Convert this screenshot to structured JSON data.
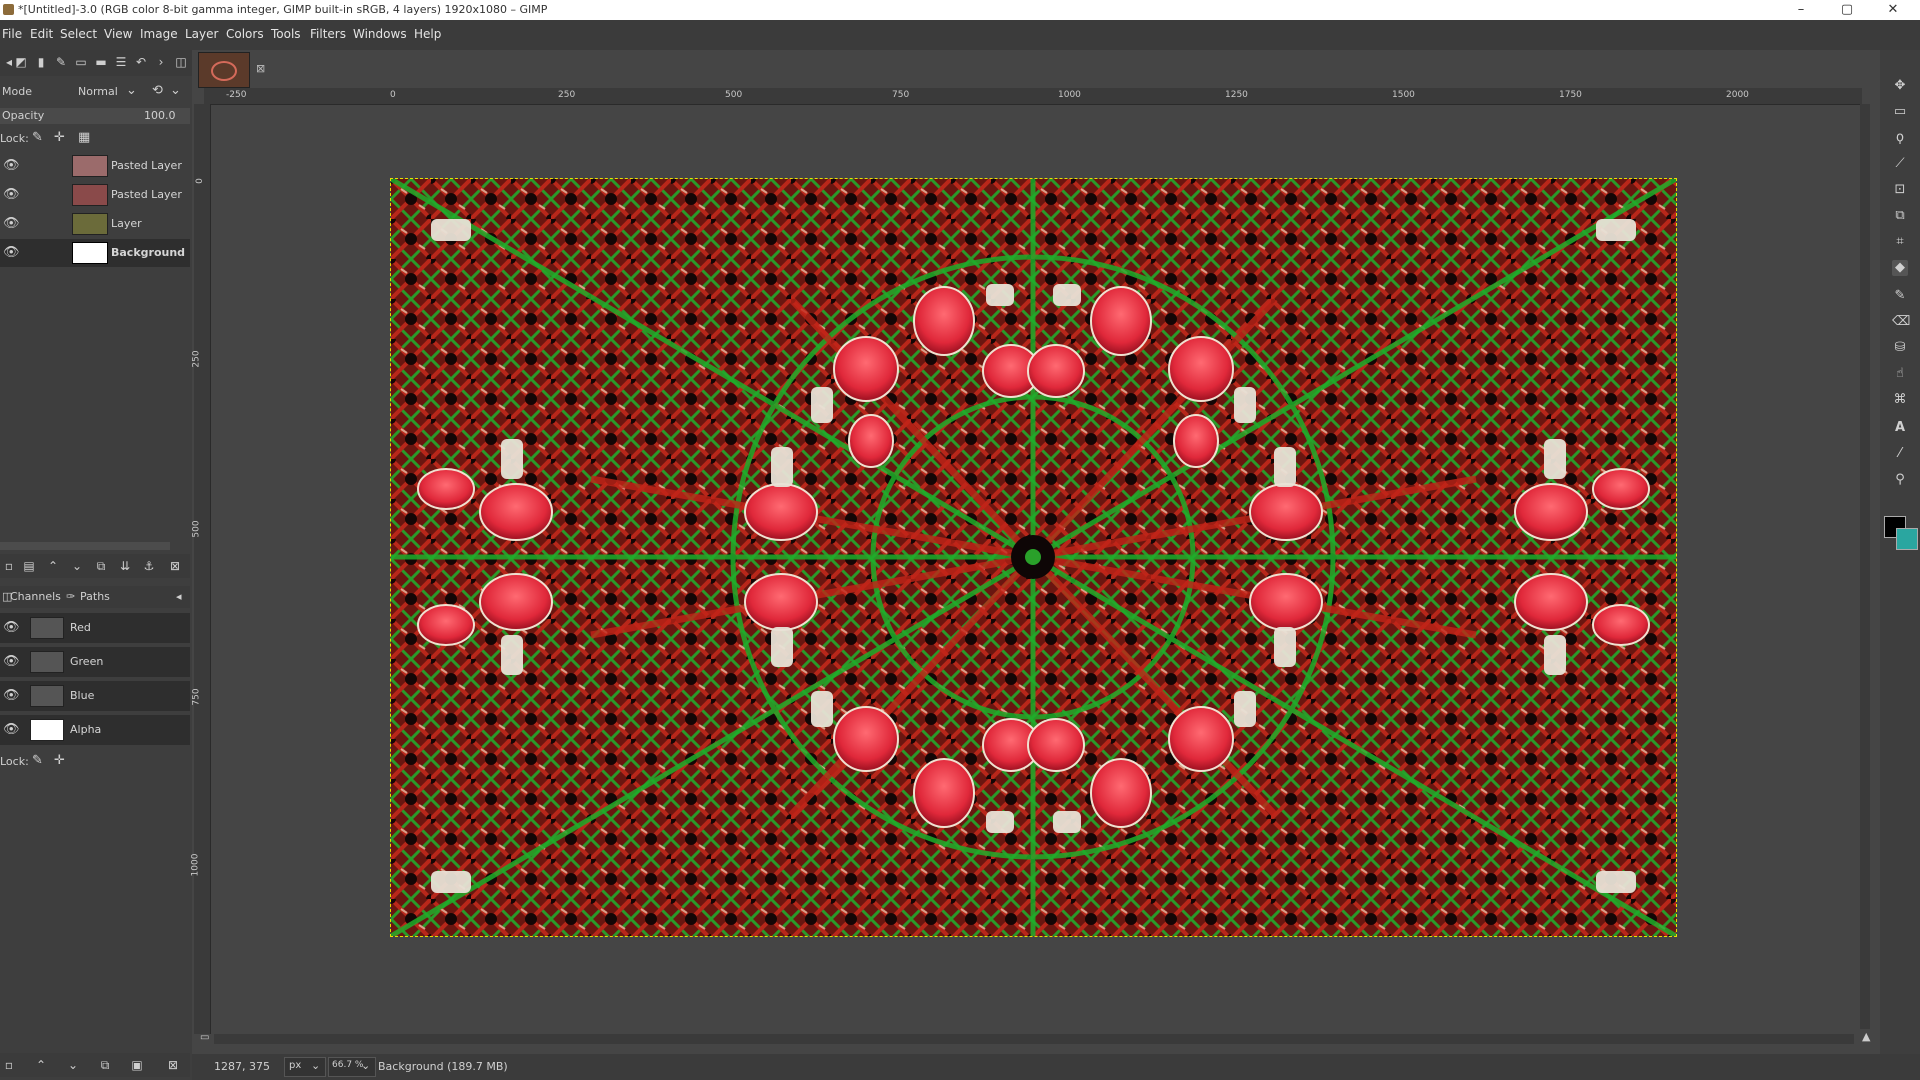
{
  "window": {
    "title": "*[Untitled]-3.0 (RGB color 8-bit gamma integer, GIMP built-in sRGB, 4 layers) 1920x1080 – GIMP",
    "controls": [
      "–",
      "▢",
      "✕"
    ]
  },
  "menu": [
    "File",
    "Edit",
    "Select",
    "View",
    "Image",
    "Layer",
    "Colors",
    "Tools",
    "Filters",
    "Windows",
    "Help"
  ],
  "layers_panel": {
    "mode_label": "Mode",
    "mode_value": "Normal",
    "opacity_label": "Opacity",
    "opacity_value": "100.0",
    "lock_label": "Lock:",
    "layers": [
      {
        "name": "Pasted Layer",
        "visible": true,
        "thumb_color": "#9b6b6b"
      },
      {
        "name": "Pasted Layer",
        "visible": true,
        "thumb_color": "#8a4a4a"
      },
      {
        "name": "Layer",
        "visible": true,
        "thumb_color": "#6b6b3a"
      },
      {
        "name": "Background",
        "visible": true,
        "thumb_color": "#ffffff",
        "selected": true
      }
    ]
  },
  "channels_panel": {
    "tab_channels": "Channels",
    "tab_paths": "Paths",
    "lock_label": "Lock:",
    "channels": [
      {
        "name": "Red",
        "thumb_color": "#555555"
      },
      {
        "name": "Green",
        "thumb_color": "#555555"
      },
      {
        "name": "Blue",
        "thumb_color": "#555555"
      },
      {
        "name": "Alpha",
        "thumb_color": "#ffffff"
      }
    ]
  },
  "ruler": {
    "top_ticks": [
      "-250",
      "0",
      "250",
      "500",
      "750",
      "1000",
      "1250",
      "1500",
      "1750",
      "2000"
    ],
    "left_ticks": [
      "0",
      "250",
      "500",
      "750",
      "1000"
    ]
  },
  "statusbar": {
    "coords": "1287, 375",
    "unit": "px",
    "zoom": "66.7 %",
    "info": "Background (189.7 MB)"
  },
  "colors": {
    "fg": "#000000",
    "bg": "#2aa6a0"
  }
}
